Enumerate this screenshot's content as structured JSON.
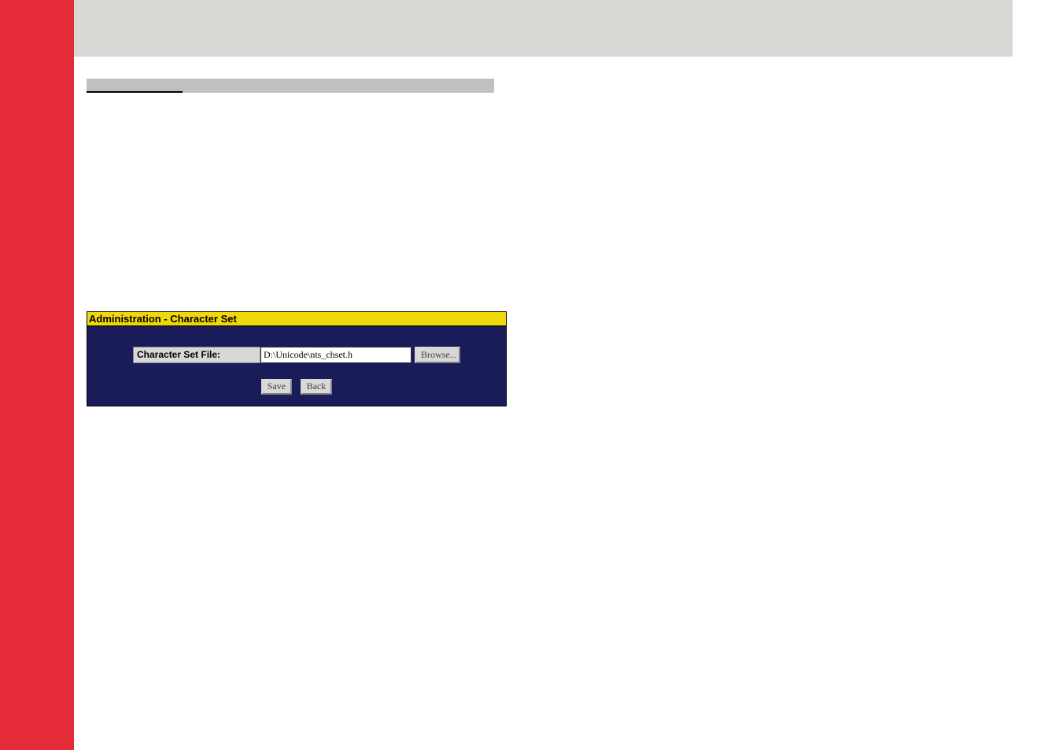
{
  "panel": {
    "title": "Administration - Character Set",
    "field_label": "Character Set File:",
    "file_value": "D:\\Unicode\\nts_chset.h",
    "browse_label": "Browse...",
    "save_label": "Save",
    "back_label": "Back"
  }
}
